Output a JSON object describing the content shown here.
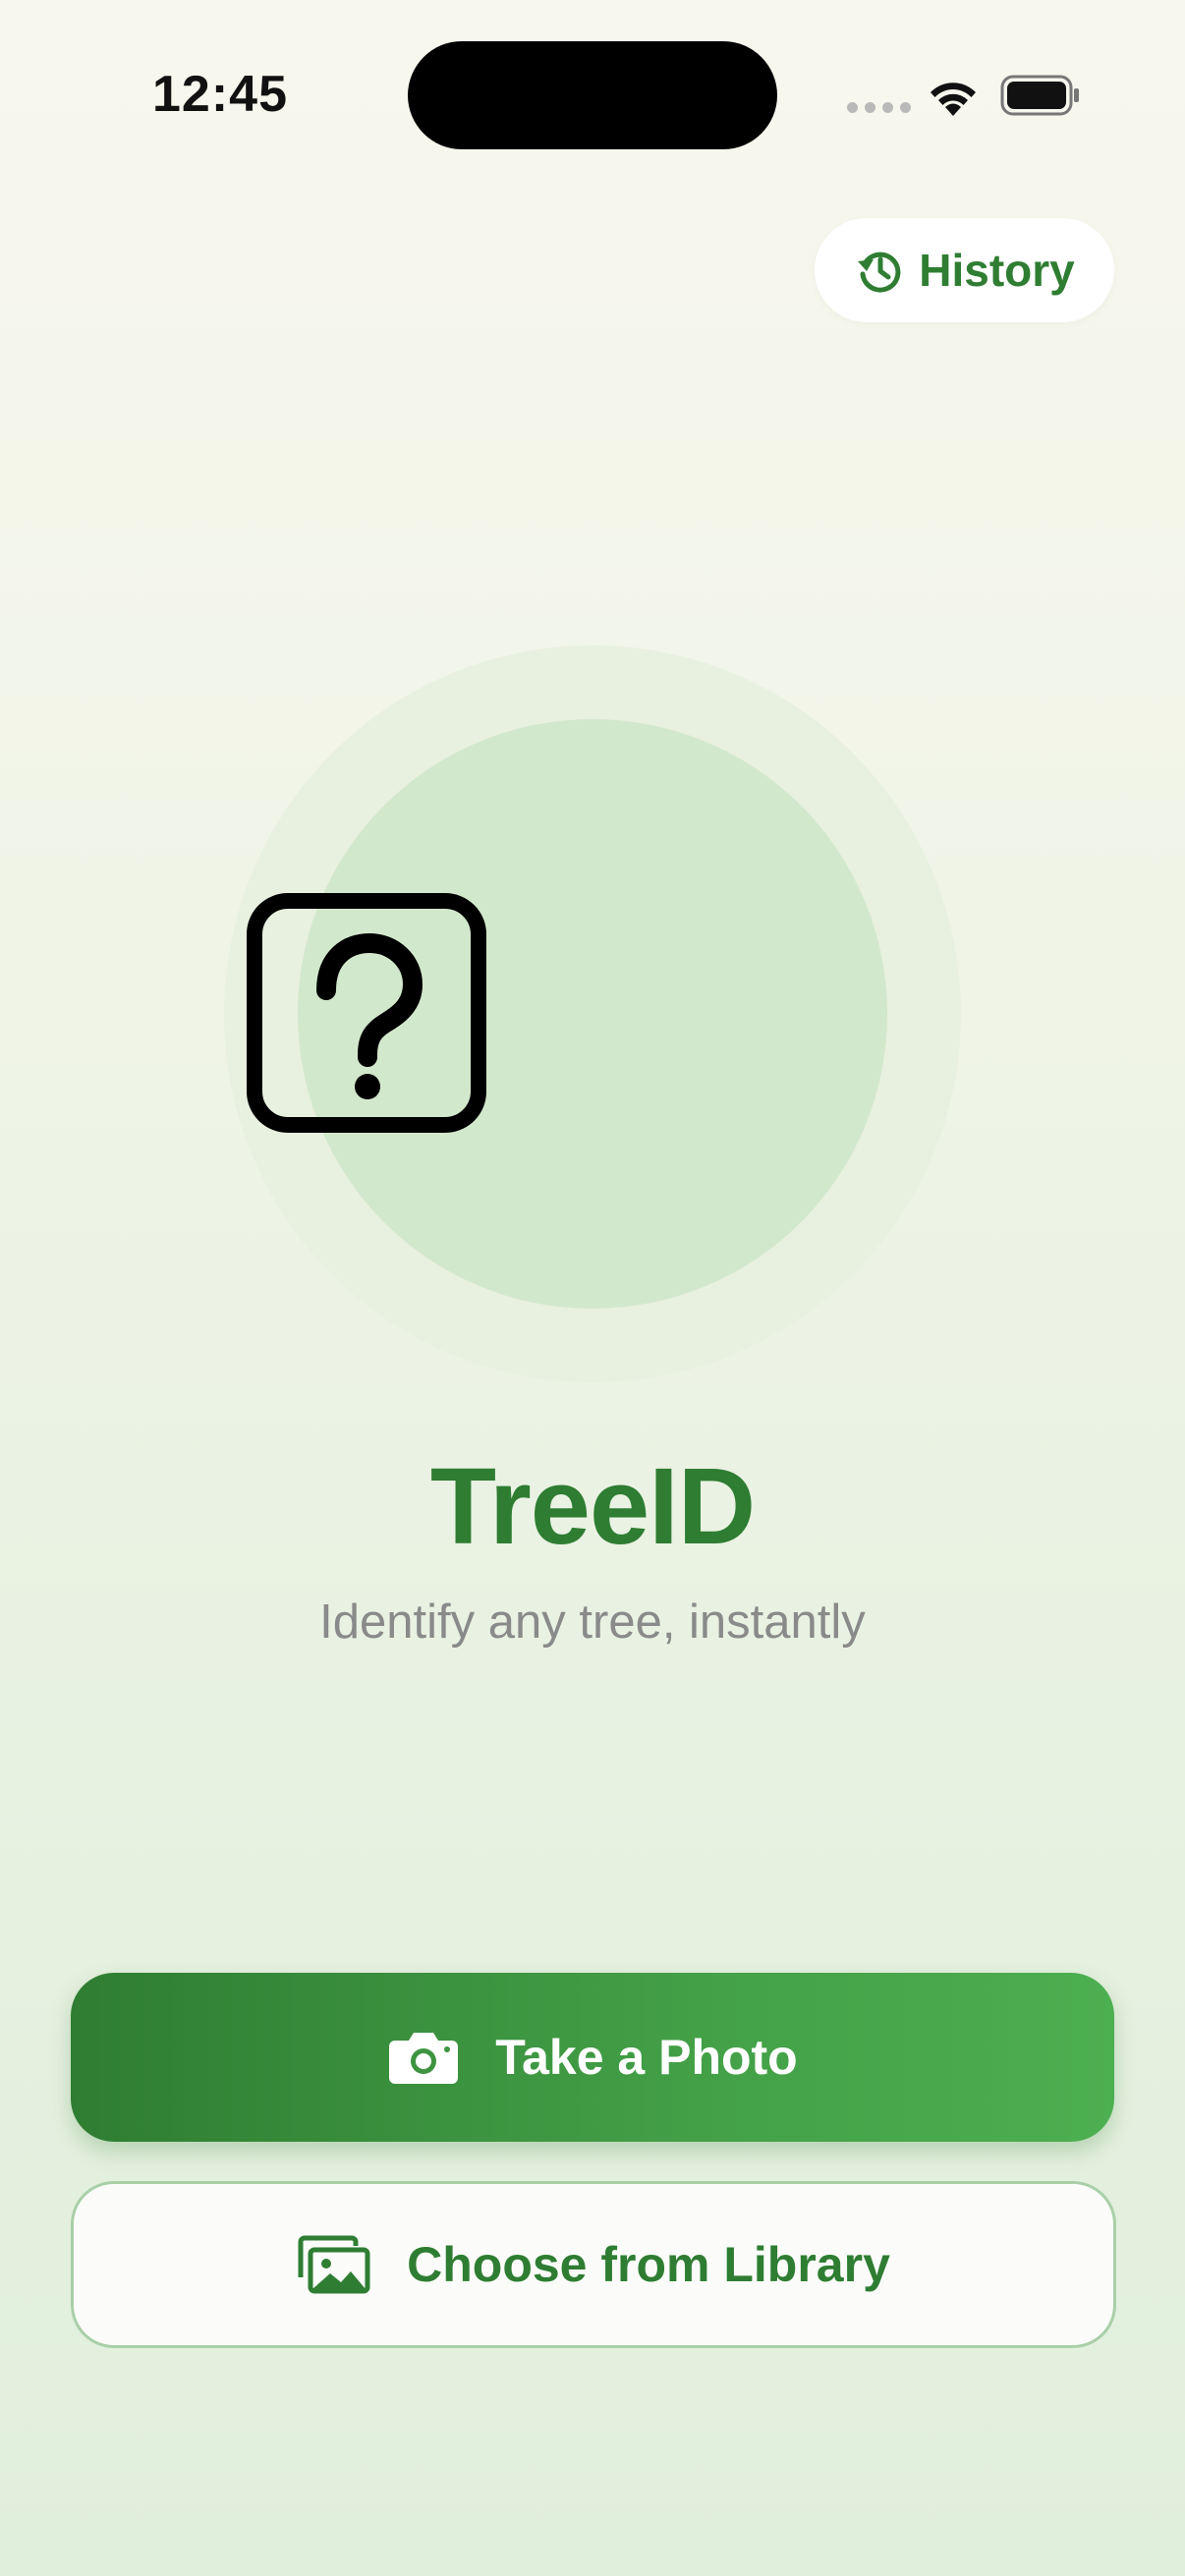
{
  "status_bar": {
    "time": "12:45"
  },
  "header": {
    "history_label": "History"
  },
  "hero": {
    "icon": "question-square-icon"
  },
  "app": {
    "title": "TreeID",
    "tagline": "Identify any tree, instantly"
  },
  "actions": {
    "take_photo_label": "Take a Photo",
    "take_photo_icon": "camera-icon",
    "library_label": "Choose from Library",
    "library_icon": "photo-library-icon"
  },
  "colors": {
    "accent": "#2e7d32",
    "accent_light": "#4caf50",
    "tagline": "#8a8a8a",
    "hero_inner": "#d2e8cc",
    "hero_outer": "#e8f0df"
  }
}
